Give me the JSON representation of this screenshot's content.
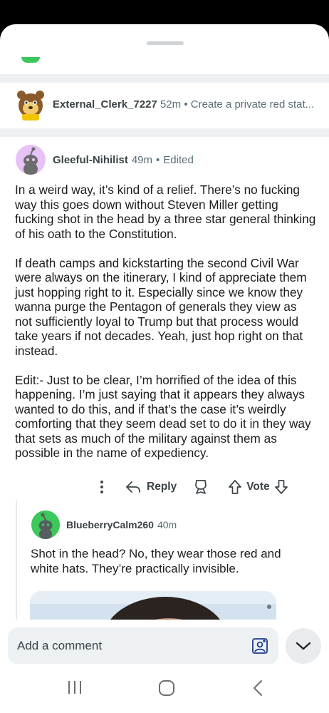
{
  "collapsed_comment": {
    "author": "External_Clerk_7227",
    "age": "52m",
    "separator": "•",
    "preview": "Create a private red stat..."
  },
  "comment": {
    "author": "Gleeful-Nihilist",
    "age": "49m",
    "separator": "•",
    "edited": "Edited",
    "paragraphs": [
      "In a weird way, it’s kind of a relief. There’s no fucking way this goes down without Steven Miller getting fucking shot in the head by a three star general thinking of his oath to the Constitution.",
      "If death camps and kickstarting the second Civil War were always on the itinerary, I kind of appreciate them just hopping right to it. Especially since we know they wanna purge the Pentagon of generals they view as not sufficiently loyal to Trump but that process would take years if not decades. Yeah, just hop right on that instead.",
      "Edit:- Just to be clear, I’m horrified of the idea of this happening. I’m just saying that it appears they always wanted to do this, and if that’s the case it’s weirdly comforting that they seem dead set to do it in they way that sets as much of the military against them as possible in the name of expediency."
    ],
    "actions": {
      "reply_label": "Reply",
      "vote_label": "Vote"
    }
  },
  "reply": {
    "author": "BlueberryCalm260",
    "age": "40m",
    "text": "Shot in the head? No, they wear those red and white hats. They’re practically invisible."
  },
  "composer": {
    "placeholder": "Add a comment"
  },
  "colors": {
    "accent_green": "#3cc85b",
    "avatar_purple": "#e7c2f5",
    "text_primary": "#1c1c1c",
    "text_secondary": "#576f76"
  },
  "icons": {
    "more": "more-vertical-icon",
    "reply": "reply-arrow-icon",
    "award": "award-icon",
    "upvote": "upvote-icon",
    "downvote": "downvote-icon",
    "photo": "image-icon",
    "collapse": "chevron-down-icon",
    "nav_recents": "recents-icon",
    "nav_home": "home-icon",
    "nav_back": "back-icon"
  }
}
